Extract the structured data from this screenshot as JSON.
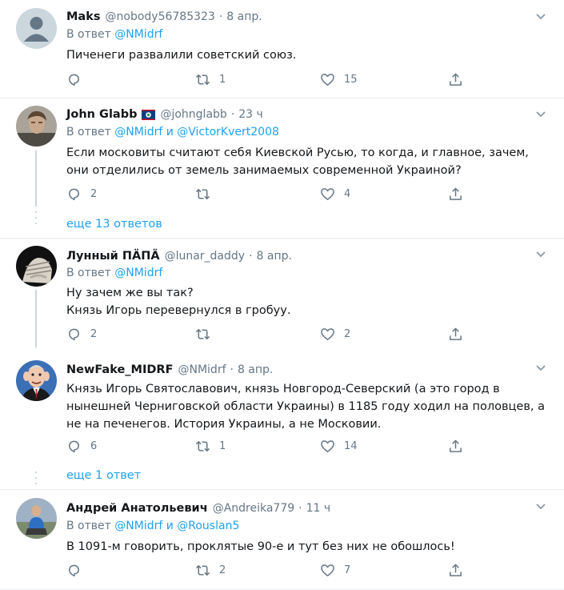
{
  "colors": {
    "link": "#1da1f2",
    "muted": "#657786",
    "text": "#14171a",
    "border": "#e6ecf0"
  },
  "tweets": [
    {
      "name": "Maks",
      "handle": "@nobody56785323",
      "dot": "·",
      "time": "8 апр.",
      "reply_prefix": "В ответ ",
      "reply_to": [
        "@NMidrf"
      ],
      "reply_joiner": "",
      "text": "Пиченеги развалили советский союз.",
      "reply_count": "",
      "retweet_count": "1",
      "like_count": "15",
      "avatar": "default-avatar"
    },
    {
      "name": "John Glabb",
      "handle": "@johnglabb",
      "dot": "·",
      "time": "23 ч",
      "reply_prefix": "В ответ ",
      "reply_to": [
        "@NMidrf",
        "@VictorKvert2008"
      ],
      "reply_joiner": " и ",
      "text": "Если московиты считают себя Киевской Русью, то когда, и главное, зачем, они отделились от земель занимаемых современной Украиной?",
      "reply_count": "2",
      "retweet_count": "",
      "like_count": "4",
      "show_more": "еще 13 ответов",
      "flag": "belize-flag-icon",
      "avatar": "photo-avatar"
    },
    {
      "name": "Лунный ПÄПÄ",
      "handle": "@lunar_daddy",
      "dot": "·",
      "time": "8 апр.",
      "reply_prefix": "В ответ ",
      "reply_to": [
        "@NMidrf"
      ],
      "reply_joiner": "",
      "text": "Ну зачем же вы так?\nКнязь Игорь перевернулся в гробуу.",
      "reply_count": "2",
      "retweet_count": "",
      "like_count": "2",
      "avatar": "bound-hands-avatar"
    },
    {
      "name": "NewFake_MIDRF",
      "handle": "@NMidrf",
      "dot": "·",
      "time": "8 апр.",
      "text": "Князь Игорь Святославович, князь Новгород-Северский (а это город в нынешней Черниговской области Украины) в 1185 году ходил на половцев, а не на печенегов. История Украины, а не Московии.",
      "reply_count": "6",
      "retweet_count": "1",
      "like_count": "14",
      "show_more": "еще 1 ответ",
      "avatar": "caricature-avatar"
    },
    {
      "name": "Андрей Анатольевич",
      "handle": "@Andreika779",
      "dot": "·",
      "time": "11 ч",
      "reply_prefix": "В ответ ",
      "reply_to": [
        "@NMidrf",
        "@Rouslan5"
      ],
      "reply_joiner": " и ",
      "text": "В 1091-м говорить, проклятые 90-е и тут без них не обошлось!",
      "reply_count": "",
      "retweet_count": "2",
      "like_count": "7",
      "avatar": "photo-avatar"
    }
  ]
}
